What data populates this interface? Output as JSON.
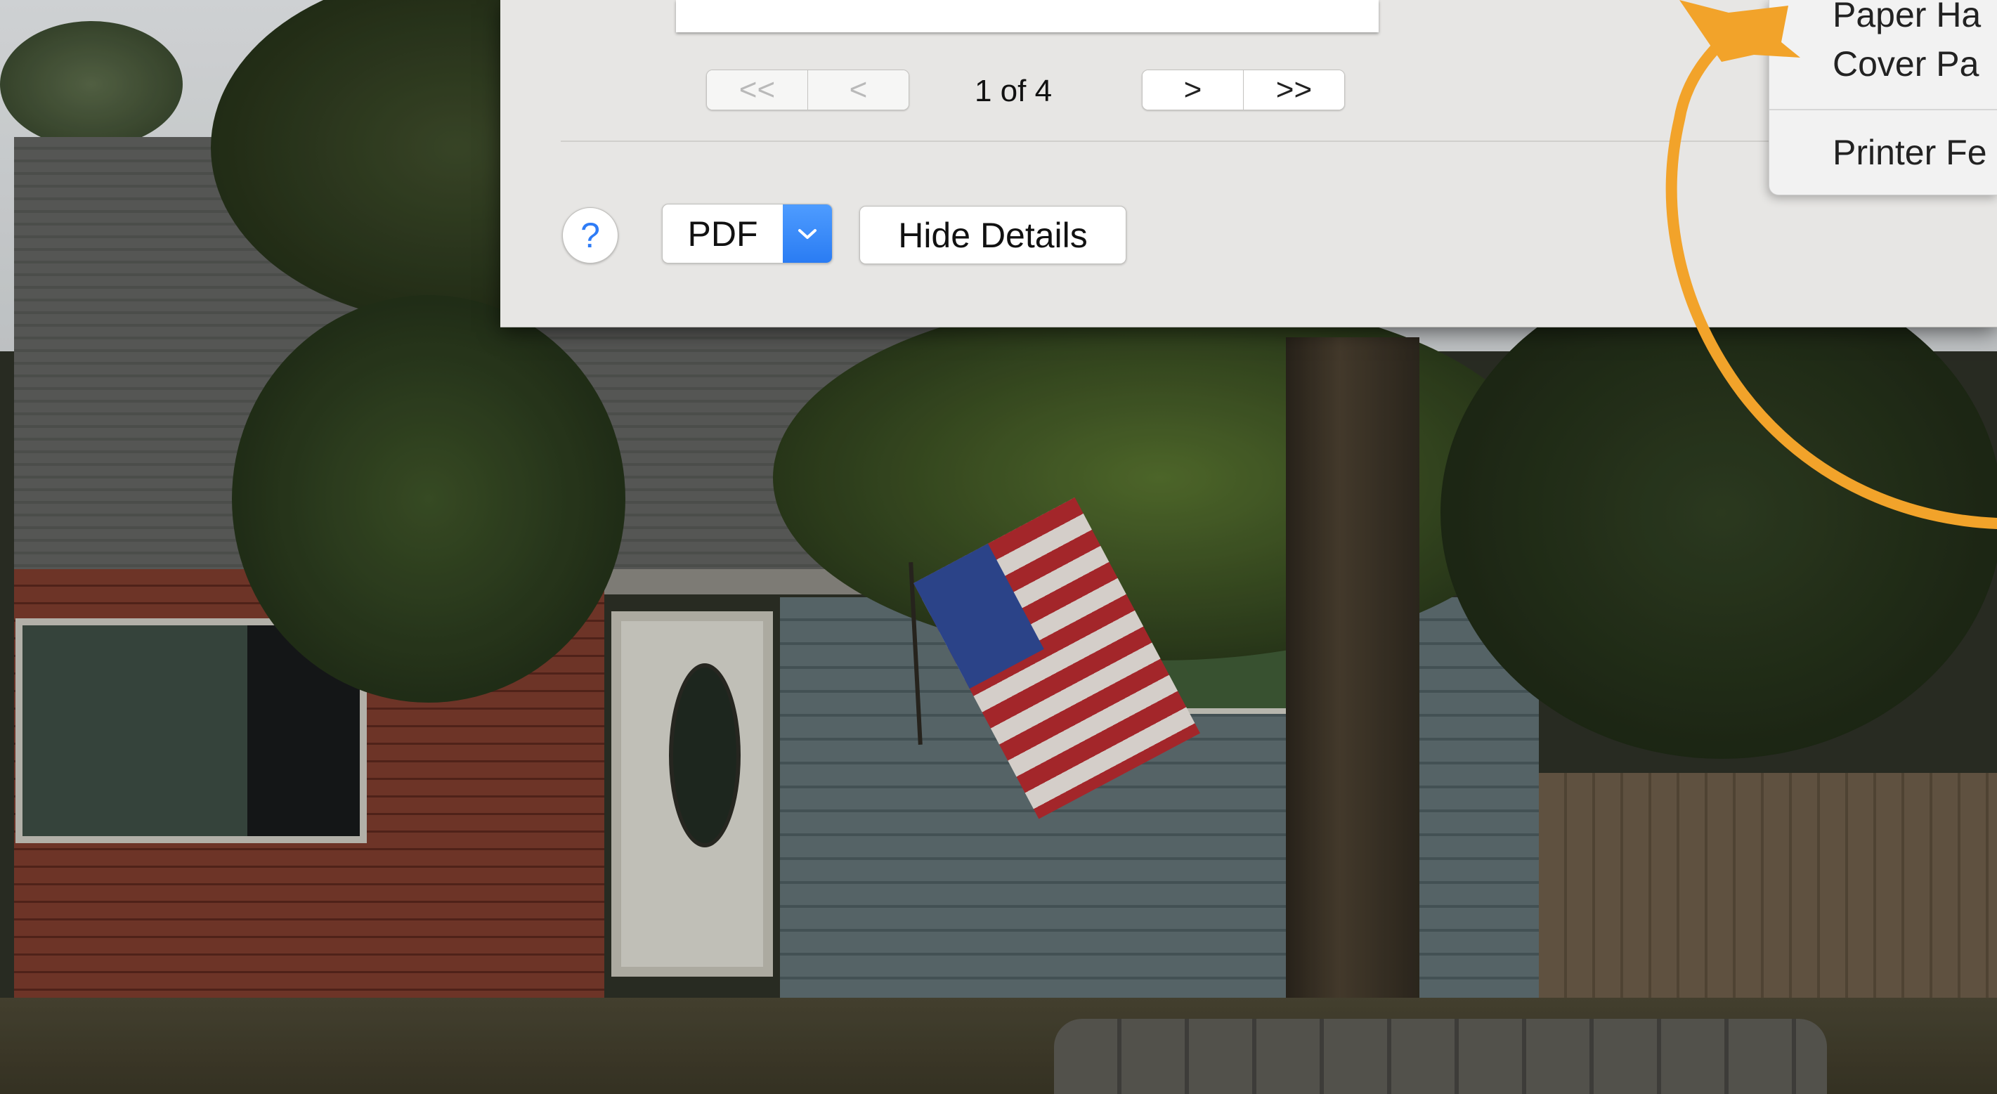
{
  "print_dialog": {
    "navigation": {
      "first_page_label": "<<",
      "prev_page_label": "<",
      "page_indicator": "1 of 4",
      "next_page_label": ">",
      "last_page_label": ">>"
    },
    "help_label": "?",
    "pdf_label": "PDF",
    "hide_details_label": "Hide Details"
  },
  "menu": {
    "items": [
      "Paper Ha",
      "Cover Pa",
      "Printer Fe"
    ]
  },
  "colors": {
    "accent": "#2a7cf3",
    "annotation": "#f2a32a"
  }
}
